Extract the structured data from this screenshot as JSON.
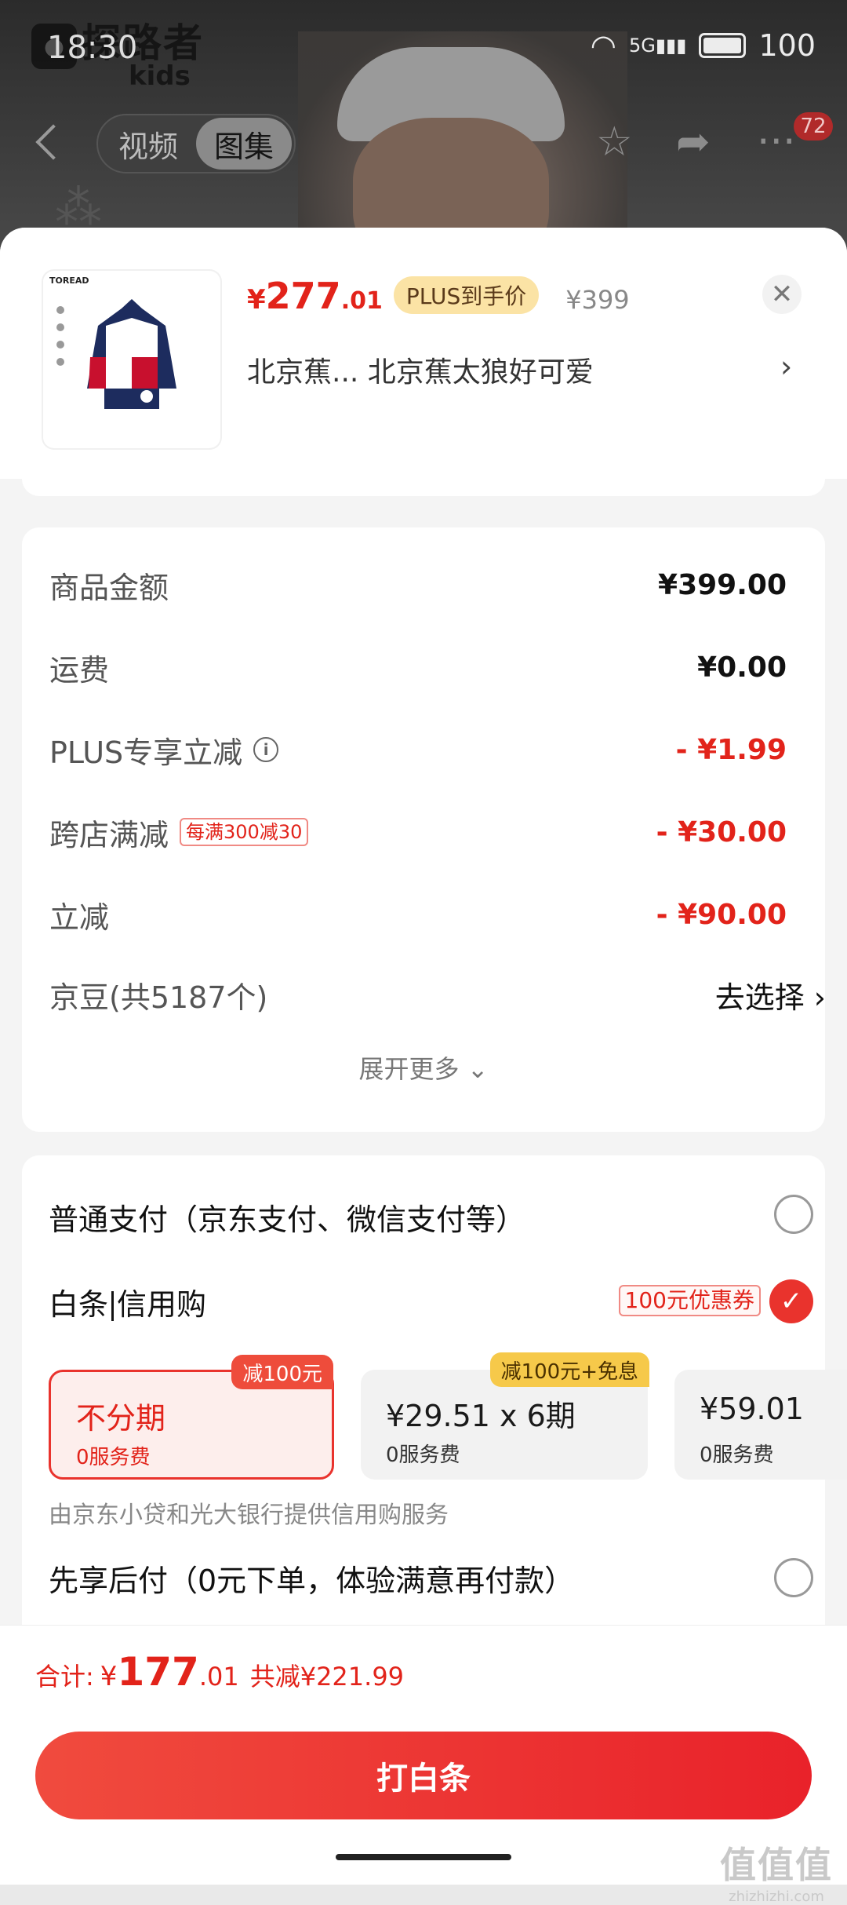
{
  "status_bar": {
    "time": "18:30",
    "network": "5G",
    "battery": "100"
  },
  "brand": {
    "name_cn": "探路者",
    "name_en": "kids"
  },
  "nav": {
    "tabs": [
      {
        "label": "视频"
      },
      {
        "label": "图集"
      }
    ],
    "message_count": "72"
  },
  "product": {
    "thumb_brand": "TOREAD",
    "price_symbol": "¥",
    "price_int": "277",
    "price_dec": ".01",
    "plus_tag": "PLUS到手价",
    "original_price": "¥399",
    "spec": "北京蕉...  北京蕉太狼好可爱"
  },
  "amounts": [
    {
      "label": "商品金额",
      "value": "¥399.00"
    },
    {
      "label": "运费",
      "value": "¥0.00"
    },
    {
      "label": "PLUS专享立减",
      "value": "- ¥1.99"
    },
    {
      "label": "跨店满减",
      "tag": "每满300减30",
      "value": "- ¥30.00"
    },
    {
      "label": "立减",
      "value": "- ¥90.00"
    },
    {
      "label": "京豆(共5187个)",
      "value": "去选择"
    }
  ],
  "expand_label": "展开更多",
  "payment": {
    "normal": {
      "label": "普通支付（京东支付、微信支付等）"
    },
    "baitiao": {
      "label_a": "白条",
      "label_b": "信用购",
      "coupon": "100元优惠券"
    },
    "plans": [
      {
        "title": "不分期",
        "sub": "0服务费",
        "badge": "减100元"
      },
      {
        "title": "¥29.51 x 6期",
        "sub": "0服务费",
        "badge": "减100元+免息"
      },
      {
        "title": "¥59.01",
        "sub": "0服务费"
      }
    ],
    "note": "由京东小贷和光大银行提供信用购服务",
    "later": {
      "label": "先享后付（0元下单，体验满意再付款）"
    }
  },
  "footer": {
    "total_label": "合计:",
    "total_symbol": "¥",
    "total_int": "177",
    "total_dec": ".01",
    "total_save": "共减¥221.99",
    "button": "打白条"
  },
  "watermark": {
    "big": "值值值",
    "small": "zhizhizhi.com"
  }
}
